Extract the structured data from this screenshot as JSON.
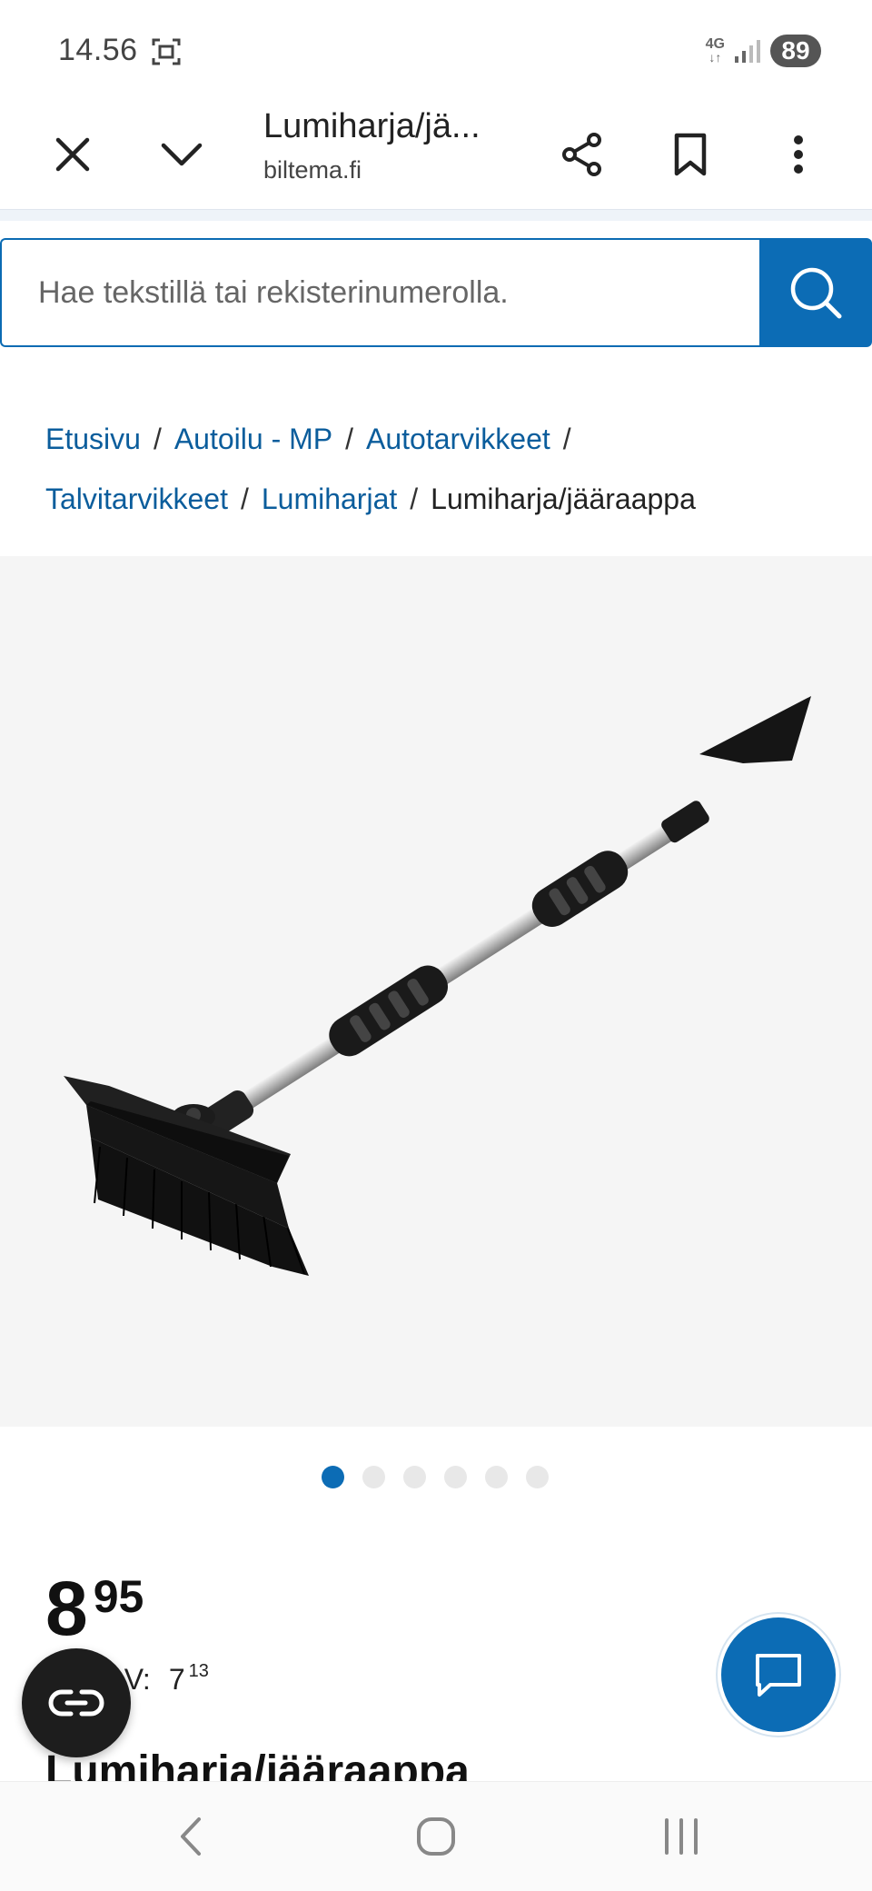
{
  "status": {
    "time": "14.56",
    "network": "4G",
    "battery": "89"
  },
  "browser": {
    "title": "Lumiharja/jä...",
    "domain": "biltema.fi"
  },
  "search": {
    "placeholder": "Hae tekstillä tai rekisterinumerolla."
  },
  "breadcrumb": [
    {
      "label": "Etusivu"
    },
    {
      "label": "Autoilu - MP"
    },
    {
      "label": "Autotarvikkeet"
    },
    {
      "label": "Talvitarvikkeet"
    },
    {
      "label": "Lumiharjat"
    }
  ],
  "breadcrumb_current": "Lumiharja/jääraappa",
  "carousel": {
    "count": 6,
    "active": 1
  },
  "price": {
    "integer": "8",
    "decimals": "95"
  },
  "alv": {
    "label": "ALV:",
    "integer": "7",
    "decimals": "13"
  },
  "product": {
    "title": "Lumiharja/jääraappa"
  },
  "colors": {
    "accent": "#0c6cb5",
    "link": "#0b5d9c",
    "image_bg": "#f5f5f5"
  },
  "icons": {
    "close": "close-icon",
    "dropdown": "chevron-down-icon",
    "share": "share-icon",
    "bookmark": "bookmark-icon",
    "menu": "more-vert-icon",
    "search": "search-icon",
    "chat": "chat-icon",
    "companion": "link-icon",
    "back": "back-icon",
    "home": "home-icon",
    "recents": "recents-icon"
  }
}
